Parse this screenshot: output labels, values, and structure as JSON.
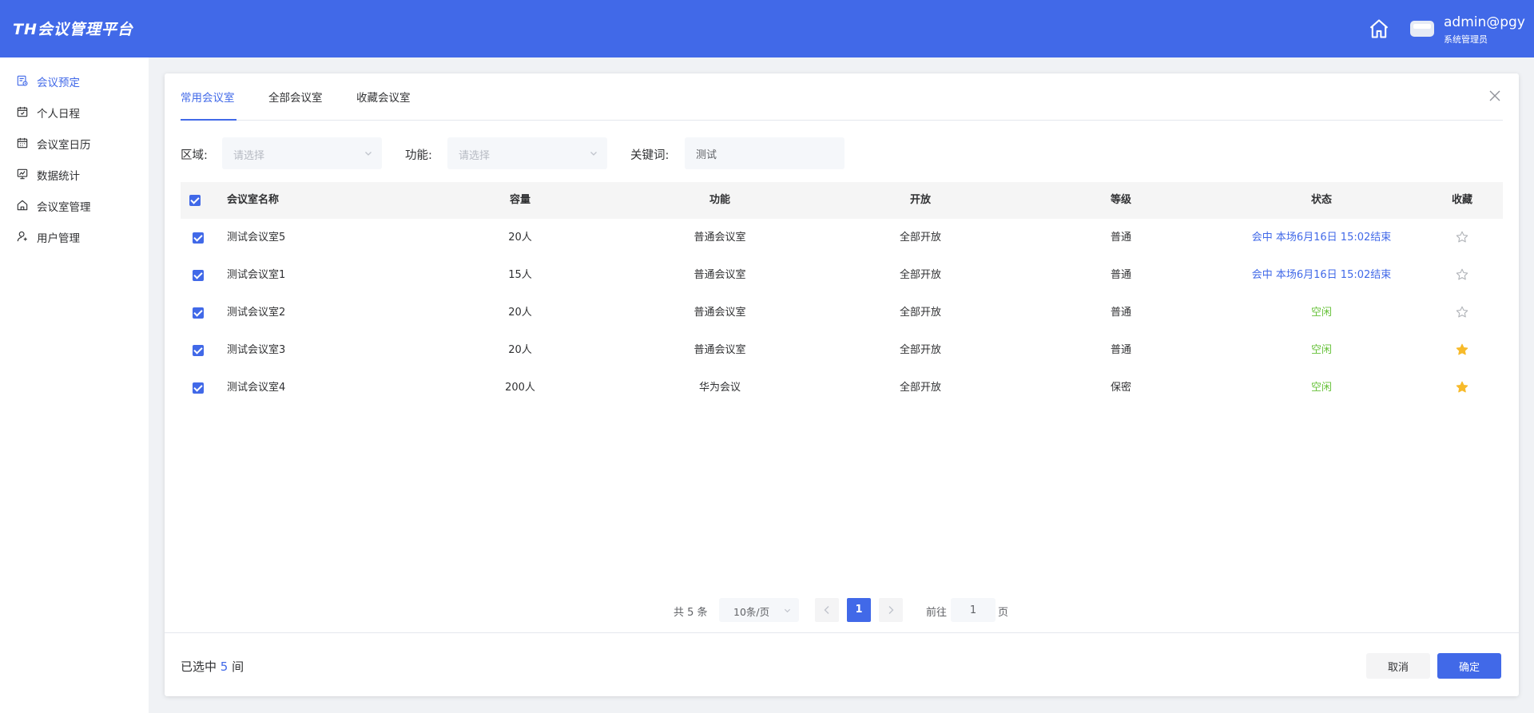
{
  "header": {
    "logo": "TH会议管理平台",
    "user_name": "admin@pgy",
    "user_role": "系统管理员"
  },
  "sidebar": {
    "items": [
      {
        "label": "会议预定",
        "icon": "booking-icon",
        "active": true
      },
      {
        "label": "个人日程",
        "icon": "schedule-icon",
        "active": false
      },
      {
        "label": "会议室日历",
        "icon": "calendar-icon",
        "active": false
      },
      {
        "label": "数据统计",
        "icon": "chart-icon",
        "active": false
      },
      {
        "label": "会议室管理",
        "icon": "building-icon",
        "active": false
      },
      {
        "label": "用户管理",
        "icon": "user-icon",
        "active": false
      }
    ]
  },
  "tabs": [
    {
      "label": "常用会议室",
      "active": true
    },
    {
      "label": "全部会议室",
      "active": false
    },
    {
      "label": "收藏会议室",
      "active": false
    }
  ],
  "filters": {
    "area_label": "区域:",
    "area_placeholder": "请选择",
    "function_label": "功能:",
    "function_placeholder": "请选择",
    "keyword_label": "关键词:",
    "keyword_value": "测试"
  },
  "table": {
    "headers": {
      "name": "会议室名称",
      "capacity": "容量",
      "function": "功能",
      "open": "开放",
      "level": "等级",
      "status": "状态",
      "favorite": "收藏"
    },
    "rows": [
      {
        "name": "测试会议室5",
        "capacity": "20人",
        "function": "普通会议室",
        "open": "全部开放",
        "level": "普通",
        "status": "会中 本场6月16日 15:02结束",
        "status_type": "busy",
        "favorite": false,
        "checked": true
      },
      {
        "name": "测试会议室1",
        "capacity": "15人",
        "function": "普通会议室",
        "open": "全部开放",
        "level": "普通",
        "status": "会中 本场6月16日 15:02结束",
        "status_type": "busy",
        "favorite": false,
        "checked": true
      },
      {
        "name": "测试会议室2",
        "capacity": "20人",
        "function": "普通会议室",
        "open": "全部开放",
        "level": "普通",
        "status": "空闲",
        "status_type": "free",
        "favorite": false,
        "checked": true
      },
      {
        "name": "测试会议室3",
        "capacity": "20人",
        "function": "普通会议室",
        "open": "全部开放",
        "level": "普通",
        "status": "空闲",
        "status_type": "free",
        "favorite": true,
        "checked": true
      },
      {
        "name": "测试会议室4",
        "capacity": "200人",
        "function": "华为会议",
        "open": "全部开放",
        "level": "保密",
        "status": "空闲",
        "status_type": "free",
        "favorite": true,
        "checked": true
      }
    ]
  },
  "pagination": {
    "total": "共 5 条",
    "page_size": "10条/页",
    "current_page": "1",
    "goto_label": "前往",
    "goto_value": "1",
    "page_suffix": "页"
  },
  "footer": {
    "selected_prefix": "已选中",
    "selected_count": "5",
    "selected_suffix": "间",
    "cancel_label": "取消",
    "ok_label": "确定"
  },
  "colors": {
    "primary": "#4169e8",
    "free": "#67c23a",
    "star": "#f7ba2a"
  }
}
